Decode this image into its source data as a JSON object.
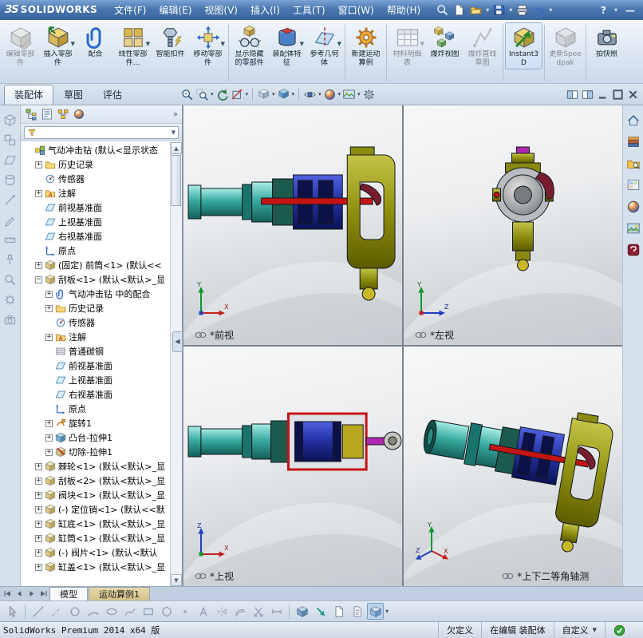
{
  "colors": {
    "titlebar_blue": "#4a77ae",
    "drill_teal": "#3aaca2",
    "drill_blue": "#1c2a8e",
    "drill_olive": "#8f9010",
    "drill_red": "#c41414",
    "drill_magenta": "#b028b0"
  },
  "titlebar": {
    "logo_mark": "ЗS",
    "logo_text": "SOLIDWORKS",
    "menus": [
      "文件(F)",
      "编辑(E)",
      "视图(V)",
      "插入(I)",
      "工具(T)",
      "窗口(W)",
      "帮助(H)"
    ],
    "quick_access_icons": [
      "search",
      "new-doc",
      "open",
      "save",
      "print",
      "undo"
    ],
    "help_label": "?"
  },
  "ribbon": {
    "tabs": [
      {
        "label": "装配体",
        "active": true
      },
      {
        "label": "草图",
        "active": false
      },
      {
        "label": "评估",
        "active": false
      }
    ],
    "buttons": [
      {
        "label": "编辑零部件",
        "icon": "edit-component",
        "disabled": true
      },
      {
        "label": "插入零部件",
        "icon": "insert-component",
        "arrow": true
      },
      {
        "label": "配合",
        "icon": "mate"
      },
      {
        "label": "线性零部件...",
        "icon": "linear-pattern",
        "arrow": true
      },
      {
        "label": "智能扣件",
        "icon": "smart-fastener"
      },
      {
        "label": "移动零部件",
        "icon": "move-component",
        "arrow": true,
        "sep_after": true
      },
      {
        "label": "显示隐藏的零部件",
        "icon": "show-hidden"
      },
      {
        "label": "装配体特征",
        "icon": "assembly-features",
        "arrow": true
      },
      {
        "label": "参考几何体",
        "icon": "reference-geometry",
        "arrow": true,
        "sep_after": true
      },
      {
        "label": "新建运动算例",
        "icon": "motion-study",
        "sep_after": true
      },
      {
        "label": "材料明细表",
        "icon": "bom",
        "disabled": true,
        "arrow": true
      },
      {
        "label": "爆炸视图",
        "icon": "exploded-view"
      },
      {
        "label": "爆炸直线草图",
        "icon": "explode-sketch",
        "disabled": true,
        "sep_after": true
      },
      {
        "label": "Instant3D",
        "icon": "instant3d",
        "active": true,
        "sep_after": true
      },
      {
        "label": "更新Speedpak",
        "icon": "speedpak",
        "disabled": true,
        "sep_after": true
      },
      {
        "label": "拍快照",
        "icon": "snapshot"
      }
    ]
  },
  "hud_icons": [
    "zoom-fit",
    "zoom-area",
    "prev-view",
    "section",
    "view-orient",
    "display-style",
    "hide-show",
    "appearance",
    "scene",
    "view-settings"
  ],
  "window_controls": [
    "pane-left",
    "pane-right",
    "minimize",
    "maximize",
    "close"
  ],
  "left_toolbar_icons": [
    "cube-outline",
    "two-cubes",
    "plane-outline",
    "cylinder",
    "axis",
    "pencil",
    "ruler",
    "pin",
    "magnifier",
    "gear",
    "camera"
  ],
  "task_pane_icons": [
    "home",
    "design-library",
    "file-explorer",
    "view-palette",
    "appearances",
    "scenes",
    "forum"
  ],
  "feature_tree": {
    "manager_tabs": [
      "feature-manager",
      "property-manager",
      "configuration-manager",
      "display-manager"
    ],
    "items": [
      {
        "label": "气动冲击钻 (默认<显示状态",
        "icon": "assembly",
        "level": 0
      },
      {
        "label": "历史记录",
        "icon": "folder",
        "level": 1,
        "expand": "+"
      },
      {
        "label": "传感器",
        "icon": "sensor",
        "level": 1
      },
      {
        "label": "注解",
        "icon": "annotations",
        "level": 1,
        "expand": "+"
      },
      {
        "label": "前视基准面",
        "icon": "plane",
        "level": 1
      },
      {
        "label": "上视基准面",
        "icon": "plane",
        "level": 1
      },
      {
        "label": "右视基准面",
        "icon": "plane",
        "level": 1
      },
      {
        "label": "原点",
        "icon": "origin",
        "level": 1
      },
      {
        "label": "(固定) 前筒<1> (默认<<",
        "icon": "part",
        "level": 1,
        "expand": "+"
      },
      {
        "label": "刮板<1> (默认<默认>_显",
        "icon": "part",
        "level": 1,
        "expand": "-"
      },
      {
        "label": "气动冲击钻 中的配合",
        "icon": "mates",
        "level": 2,
        "expand": "+"
      },
      {
        "label": "历史记录",
        "icon": "folder",
        "level": 2,
        "expand": "+"
      },
      {
        "label": "传感器",
        "icon": "sensor",
        "level": 2
      },
      {
        "label": "注解",
        "icon": "annotations",
        "level": 2,
        "expand": "+"
      },
      {
        "label": "普通碳钢",
        "icon": "material",
        "level": 2
      },
      {
        "label": "前视基准面",
        "icon": "plane",
        "level": 2
      },
      {
        "label": "上视基准面",
        "icon": "plane",
        "level": 2
      },
      {
        "label": "右视基准面",
        "icon": "plane",
        "level": 2
      },
      {
        "label": "原点",
        "icon": "origin",
        "level": 2
      },
      {
        "label": "旋转1",
        "icon": "revolve",
        "level": 2,
        "expand": "+"
      },
      {
        "label": "凸台-拉伸1",
        "icon": "extrude",
        "level": 2,
        "expand": "+"
      },
      {
        "label": "切除-拉伸1",
        "icon": "cut",
        "level": 2,
        "expand": "+"
      },
      {
        "label": "棘轮<1> (默认<默认>_显",
        "icon": "part",
        "level": 1,
        "expand": "+"
      },
      {
        "label": "刮板<2> (默认<默认>_显",
        "icon": "part",
        "level": 1,
        "expand": "+"
      },
      {
        "label": "阀块<1> (默认<默认>_显",
        "icon": "part",
        "level": 1,
        "expand": "+"
      },
      {
        "label": "(-) 定位销<1> (默认<<默",
        "icon": "part",
        "level": 1,
        "expand": "+"
      },
      {
        "label": "缸底<1> (默认<默认>_显",
        "icon": "part",
        "level": 1,
        "expand": "+"
      },
      {
        "label": "缸筒<1> (默认<默认>_显",
        "icon": "part",
        "level": 1,
        "expand": "+"
      },
      {
        "label": "(-) 阀片<1> (默认<默认",
        "icon": "part",
        "level": 1,
        "expand": "+"
      },
      {
        "label": "缸盖<1> (默认<默认>_显",
        "icon": "part",
        "level": 1,
        "expand": "+"
      }
    ]
  },
  "graphics": {
    "viewports": [
      {
        "label": "*前视",
        "view": "front"
      },
      {
        "label": "*左视",
        "view": "left"
      },
      {
        "label": "*上视",
        "view": "top"
      },
      {
        "label": "*上下二等角轴测",
        "view": "iso"
      }
    ]
  },
  "bottom": {
    "doc_tabs": [
      {
        "label": "模型",
        "active": true
      },
      {
        "label": "运动算例1",
        "active": false
      }
    ],
    "sketch_tool_icons": [
      "select",
      "line",
      "centerline",
      "circle",
      "arc",
      "ellipse",
      "spline",
      "rectangle",
      "polygon",
      "point",
      "text",
      "mirror",
      "offset",
      "trim",
      "dimension",
      "iso-cube",
      "teal-arrow",
      "document",
      "document2",
      "pressed-cube"
    ]
  },
  "statusbar": {
    "left": "SolidWorks Premium 2014 x64 版",
    "cells": [
      "欠定义",
      "在编辑 装配体",
      "自定义"
    ]
  }
}
